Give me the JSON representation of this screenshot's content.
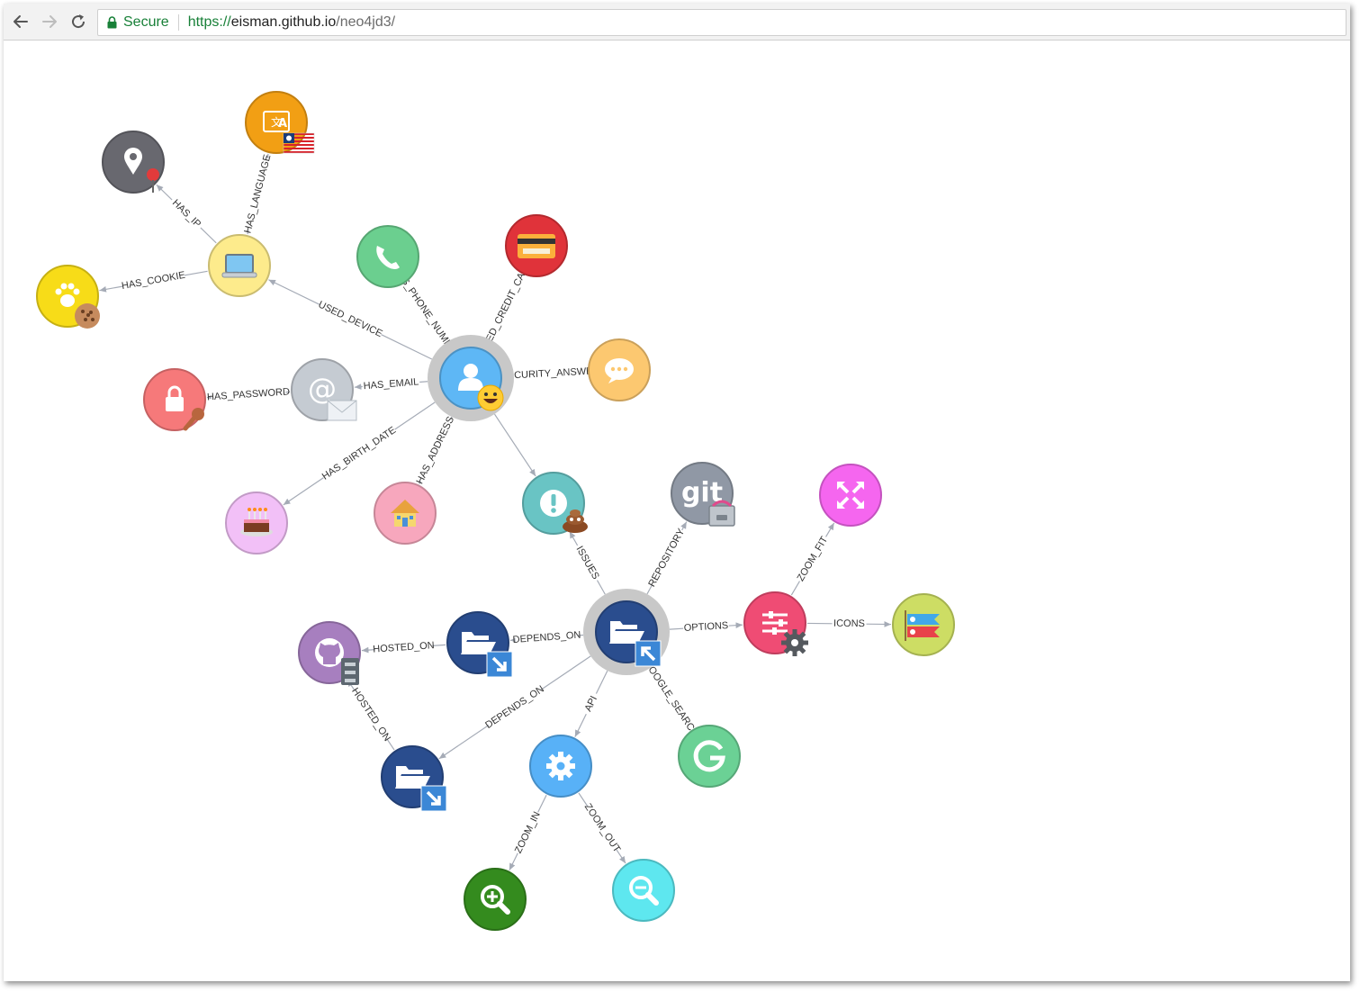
{
  "browser": {
    "secure_label": "Secure",
    "url_scheme": "https://",
    "url_host": "eisman.github.io",
    "url_path": "/neo4jd3/"
  },
  "graph": {
    "nodes": [
      {
        "id": "location",
        "icon": "map-marker",
        "color": "#68686f"
      },
      {
        "id": "language",
        "icon": "language-flag",
        "color": "#f29f14"
      },
      {
        "id": "device",
        "icon": "laptop",
        "color": "#fdeb8c"
      },
      {
        "id": "cookie",
        "icon": "paw-cookie",
        "color": "#f7dc18"
      },
      {
        "id": "phone",
        "icon": "phone",
        "color": "#6bcf8f"
      },
      {
        "id": "credit-card",
        "icon": "credit-card",
        "color": "#e0333a"
      },
      {
        "id": "user",
        "icon": "user",
        "color": "#5eb7f5"
      },
      {
        "id": "email",
        "icon": "at-envelope",
        "color": "#c5cbd2"
      },
      {
        "id": "password",
        "icon": "lock-key",
        "color": "#f6797a"
      },
      {
        "id": "security-answer",
        "icon": "comment",
        "color": "#fcc870"
      },
      {
        "id": "birthday",
        "icon": "cake",
        "color": "#f2c0f7"
      },
      {
        "id": "address",
        "icon": "house",
        "color": "#f7a7bd"
      },
      {
        "id": "issues",
        "icon": "exclamation",
        "color": "#69c4c4"
      },
      {
        "id": "git",
        "icon": "git",
        "color": "#9098a5"
      },
      {
        "id": "fullscreen",
        "icon": "expand",
        "color": "#f566ef"
      },
      {
        "id": "project",
        "icon": "folder-open",
        "color": "#2a4d8e"
      },
      {
        "id": "options",
        "icon": "sliders-gear",
        "color": "#ef4c74"
      },
      {
        "id": "icons",
        "icon": "koinobori",
        "color": "#cddd64"
      },
      {
        "id": "github",
        "icon": "github",
        "color": "#a77fbf"
      },
      {
        "id": "dependency-1",
        "icon": "folder-open",
        "color": "#2a4d8e"
      },
      {
        "id": "dependency-2",
        "icon": "folder-open",
        "color": "#2a4d8e"
      },
      {
        "id": "api",
        "icon": "gear",
        "color": "#58b1f7"
      },
      {
        "id": "google",
        "icon": "google",
        "color": "#6bd195"
      },
      {
        "id": "zoom-in",
        "icon": "search-plus",
        "color": "#348b1e"
      },
      {
        "id": "zoom-out",
        "icon": "search-minus",
        "color": "#5ee7ef"
      }
    ],
    "relationships": [
      {
        "source": "device",
        "target": "location",
        "label": "HAS_IP"
      },
      {
        "source": "device",
        "target": "language",
        "label": "HAS_LANGUAGE"
      },
      {
        "source": "device",
        "target": "cookie",
        "label": "HAS_COOKIE"
      },
      {
        "source": "user",
        "target": "device",
        "label": "USED_DEVICE"
      },
      {
        "source": "user",
        "target": "phone",
        "label": "HAS_PHONE_NUMBER"
      },
      {
        "source": "user",
        "target": "credit-card",
        "label": "USED_CREDIT_CARD"
      },
      {
        "source": "user",
        "target": "security-answer",
        "label": "SECURITY_ANSWER"
      },
      {
        "source": "user",
        "target": "email",
        "label": "HAS_EMAIL"
      },
      {
        "source": "email",
        "target": "password",
        "label": "HAS_PASSWORD"
      },
      {
        "source": "user",
        "target": "birthday",
        "label": "HAS_BIRTH_DATE"
      },
      {
        "source": "user",
        "target": "address",
        "label": "HAS_ADDRESS"
      },
      {
        "source": "user",
        "target": "issues",
        "label": ""
      },
      {
        "source": "project",
        "target": "issues",
        "label": "ISSUES"
      },
      {
        "source": "project",
        "target": "git",
        "label": "REPOSITORY"
      },
      {
        "source": "project",
        "target": "options",
        "label": "OPTIONS"
      },
      {
        "source": "options",
        "target": "fullscreen",
        "label": "ZOOM_FIT"
      },
      {
        "source": "options",
        "target": "icons",
        "label": "ICONS"
      },
      {
        "source": "project",
        "target": "dependency-1",
        "label": "DEPENDS_ON"
      },
      {
        "source": "dependency-1",
        "target": "github",
        "label": "HOSTED_ON"
      },
      {
        "source": "project",
        "target": "dependency-2",
        "label": "DEPENDS_ON"
      },
      {
        "source": "dependency-2",
        "target": "github",
        "label": "HOSTED_ON"
      },
      {
        "source": "project",
        "target": "api",
        "label": "API"
      },
      {
        "source": "project",
        "target": "google",
        "label": "GOOGLE_SEARCH"
      },
      {
        "source": "api",
        "target": "zoom-in",
        "label": "ZOOM_IN"
      },
      {
        "source": "api",
        "target": "zoom-out",
        "label": "ZOOM_OUT"
      }
    ]
  }
}
